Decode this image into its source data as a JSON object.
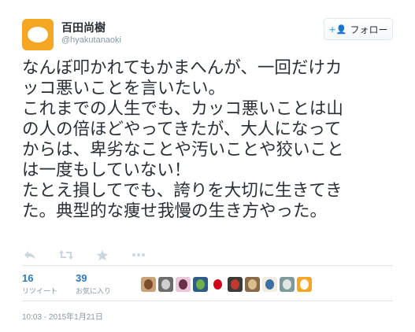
{
  "user": {
    "display_name": "百田尚樹",
    "screen_name": "@hyakutanaoki",
    "avatar_icon": "egg-avatar-icon",
    "avatar_color": "#f5a623"
  },
  "follow_button": {
    "label": "フォロー",
    "icon": "add-user-icon"
  },
  "tweet": {
    "lines": [
      "なんぼ叩かれてもかまへんが、一回だけカ",
      "ッコ悪いことを言いたい。",
      "これまでの人生でも、カッコ悪いことは山",
      "の人の倍ほどやってきたが、大人になって",
      "からは、卑劣なことや汚いことや狡いこと",
      "は一度もしていない！",
      "たとえ損してでも、誇りを大切に生きてき",
      "た。典型的な痩せ我慢の生き方やった。"
    ]
  },
  "actions": [
    {
      "name": "reply-icon",
      "glyph": "↩"
    },
    {
      "name": "retweet-icon",
      "glyph": "⇄"
    },
    {
      "name": "favorite-icon",
      "glyph": "★"
    },
    {
      "name": "more-icon",
      "glyph": "•••"
    }
  ],
  "stats": {
    "retweets": {
      "count": "16",
      "label": "リツイート"
    },
    "favorites": {
      "count": "39",
      "label": "お気に入り"
    }
  },
  "favoriters": [
    {
      "name": "favoriter-avatar-1",
      "bg": "#c9a27a",
      "fg": "#7a4e2a"
    },
    {
      "name": "favoriter-avatar-2",
      "bg": "#6d6d6d",
      "fg": "#cfcfcf"
    },
    {
      "name": "favoriter-avatar-3",
      "bg": "#e8c8d8",
      "fg": "#6a2d4a"
    },
    {
      "name": "favoriter-avatar-4",
      "bg": "#2e5b8a",
      "fg": "#6fb04a"
    },
    {
      "name": "favoriter-avatar-5",
      "bg": "#ffffff",
      "fg": "#d0021b"
    },
    {
      "name": "favoriter-avatar-6",
      "bg": "#3a3a3a",
      "fg": "#c0392b"
    },
    {
      "name": "favoriter-avatar-7",
      "bg": "#8a6a4a",
      "fg": "#d9c08a"
    },
    {
      "name": "favoriter-avatar-8",
      "bg": "#f0ede0",
      "fg": "#3a6ea5"
    },
    {
      "name": "favoriter-avatar-9",
      "bg": "#7f9a9a",
      "fg": "#e0e6e6"
    },
    {
      "name": "favoriter-avatar-10",
      "bg": "#f5a623",
      "fg": "#ffffff"
    }
  ],
  "timestamp": "10:03 - 2015年1月21日"
}
